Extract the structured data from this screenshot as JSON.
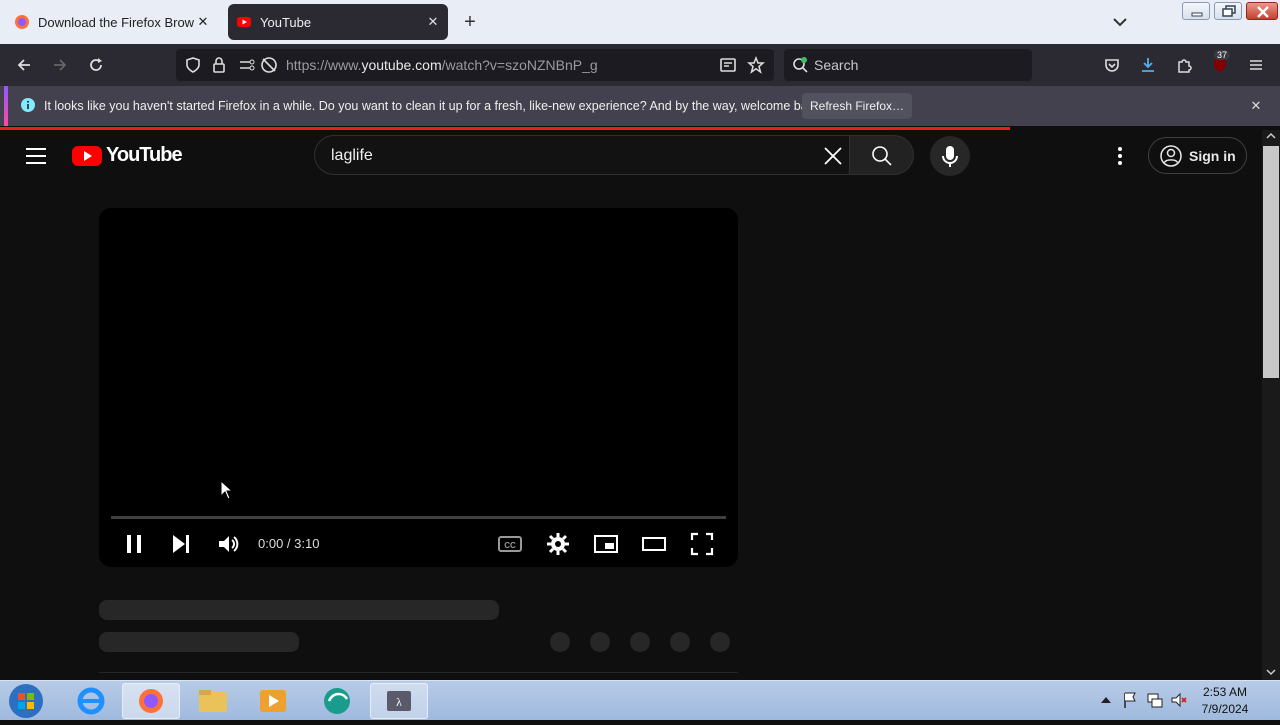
{
  "browser": {
    "tabs": [
      {
        "title": "Download the Firefox Browser in",
        "active": false
      },
      {
        "title": "YouTube",
        "active": true
      }
    ],
    "url": {
      "prefix": "https://www.",
      "host": "youtube.com",
      "path": "/watch?v=szoNZNBnP_g"
    },
    "search_placeholder": "Search",
    "extension_badge": "37"
  },
  "notification": {
    "message": "It looks like you haven't started Firefox in a while. Do you want to clean it up for a fresh, like-new experience? And by the way, welcome back!",
    "button": "Refresh Firefox…"
  },
  "youtube": {
    "logo_text": "YouTube",
    "search_value": "laglife",
    "signin_label": "Sign in",
    "player": {
      "time": "0:00 / 3:10"
    }
  },
  "taskbar": {
    "time": "2:53 AM",
    "date": "7/9/2024"
  },
  "colors": {
    "brand_red": "#ff0000",
    "progress": "#e62117",
    "background": "#0f0f0f"
  }
}
